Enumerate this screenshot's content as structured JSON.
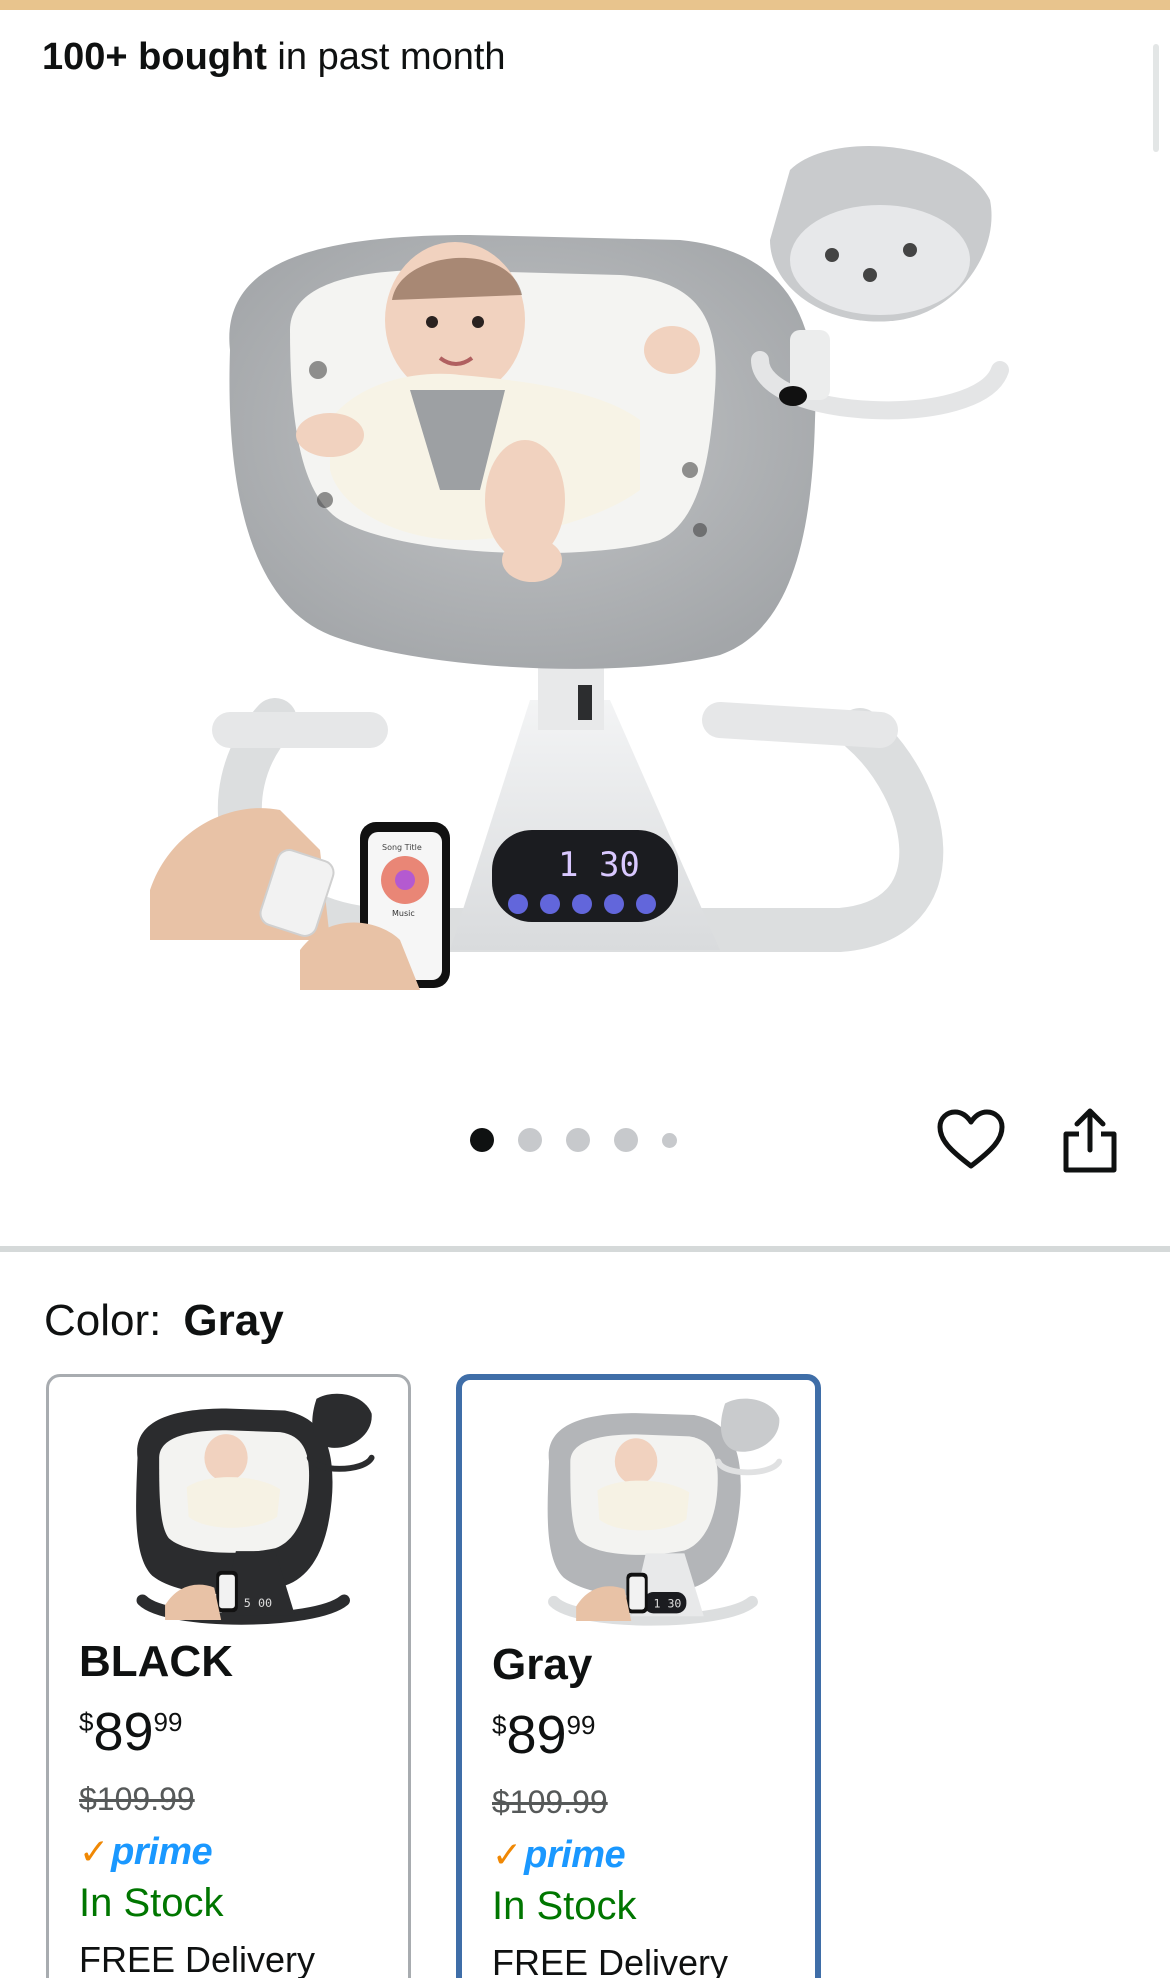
{
  "banner": {
    "bought_strong": "100+ bought",
    "bought_rest": " in past month"
  },
  "gallery": {
    "image_count": 5,
    "active_index": 0,
    "display_readout": "1 30",
    "phone_song_title": "Song Title",
    "phone_label": "Music"
  },
  "actions": {
    "favorite_icon": "heart-outline-icon",
    "share_icon": "share-icon"
  },
  "color_selector": {
    "label": "Color:",
    "selected_value": "Gray",
    "options": [
      {
        "name": "BLACK",
        "price_symbol": "$",
        "price_whole": "89",
        "price_fraction": "99",
        "list_price": "$109.99",
        "prime_check": "✓",
        "prime_word": "prime",
        "stock": "In Stock",
        "delivery": "FREE Delivery",
        "display_readout": "5 00",
        "selected": false
      },
      {
        "name": "Gray",
        "price_symbol": "$",
        "price_whole": "89",
        "price_fraction": "99",
        "list_price": "$109.99",
        "prime_check": "✓",
        "prime_word": "prime",
        "stock": "In Stock",
        "delivery": "FREE Delivery",
        "display_readout": "1 30",
        "selected": true
      }
    ]
  },
  "colors": {
    "prime_blue": "#1a98ff",
    "prime_check": "#f08804",
    "in_stock": "#007600",
    "selected_border": "#3f6ea8",
    "top_strip": "#e8c48d"
  }
}
